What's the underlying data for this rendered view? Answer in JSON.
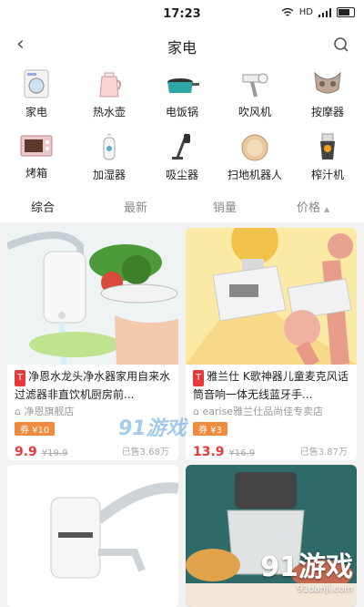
{
  "status": {
    "time": "17:23",
    "network": "HD"
  },
  "header": {
    "title": "家电"
  },
  "categories": [
    {
      "label": "家电",
      "icon": "washing-machine-icon"
    },
    {
      "label": "热水壶",
      "icon": "kettle-icon"
    },
    {
      "label": "电饭锅",
      "icon": "rice-cooker-icon"
    },
    {
      "label": "吹风机",
      "icon": "hair-dryer-icon"
    },
    {
      "label": "按摩器",
      "icon": "massager-icon"
    },
    {
      "label": "烤箱",
      "icon": "oven-icon"
    },
    {
      "label": "加湿器",
      "icon": "humidifier-icon"
    },
    {
      "label": "吸尘器",
      "icon": "vacuum-icon"
    },
    {
      "label": "扫地机器人",
      "icon": "robot-vacuum-icon"
    },
    {
      "label": "榨汁机",
      "icon": "juicer-icon"
    }
  ],
  "sort": {
    "tabs": [
      "综合",
      "最新",
      "销量",
      "价格"
    ],
    "active": "综合"
  },
  "products": [
    {
      "tag": "T",
      "name": "净恩水龙头净水器家用自来水过滤器非直饮机厨房前...",
      "shop": "净恩旗舰店",
      "coupon": "券 ¥10",
      "price": "9.9",
      "original": "¥19.9",
      "sold": "已售3.68万"
    },
    {
      "tag": "T",
      "name": "雅兰仕 K歌神器儿童麦克风话筒音响一体无线蓝牙手...",
      "shop": "earise雅兰仕品尚佳专卖店",
      "coupon": "券 ¥3",
      "price": "13.9",
      "original": "¥16.9",
      "sold": "已售3.87万"
    }
  ],
  "watermark": {
    "text": "91游戏",
    "sub": "91danji.com"
  }
}
